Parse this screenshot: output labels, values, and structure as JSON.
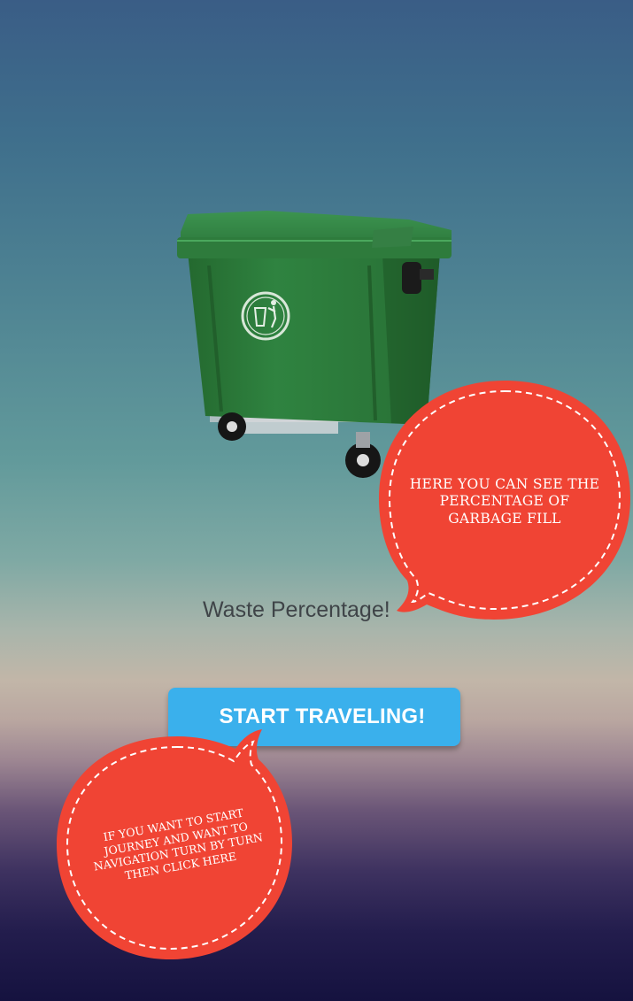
{
  "bin": {
    "image_name": "green-wheelie-bin-icon",
    "color": "#2e7d3a"
  },
  "waste_label": "Waste Percentage!",
  "start_button_label": "START TRAVELING!",
  "tooltips": {
    "right": "HERE YOU CAN SEE THE PERCENTAGE OF GARBAGE FILL",
    "left": "IF YOU WANT TO START JOURNEY AND WANT TO NAVIGATION TURN BY TURN THEN CLICK HERE"
  },
  "colors": {
    "accent": "#3ab0ec",
    "bubble": "#f04434",
    "bin": "#2e7d3a"
  }
}
